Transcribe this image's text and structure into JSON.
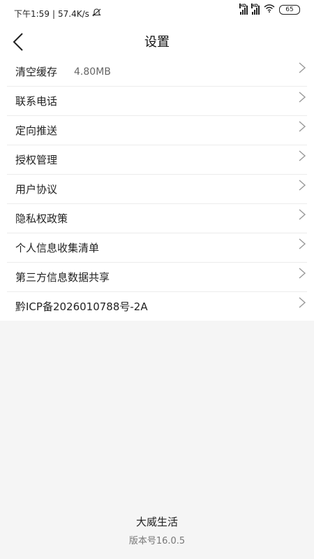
{
  "status": {
    "time": "下午1:59",
    "net_speed": "57.4K/s",
    "battery": "65",
    "signal_label": "HD"
  },
  "header": {
    "title": "设置"
  },
  "settings": [
    {
      "label": "清空缓存",
      "value": "4.80MB"
    },
    {
      "label": "联系电话",
      "value": ""
    },
    {
      "label": "定向推送",
      "value": ""
    },
    {
      "label": "授权管理",
      "value": ""
    },
    {
      "label": "用户协议",
      "value": ""
    },
    {
      "label": "隐私权政策",
      "value": ""
    },
    {
      "label": "个人信息收集清单",
      "value": ""
    },
    {
      "label": "第三方信息数据共享",
      "value": ""
    },
    {
      "label": "黔ICP备2026010788号-2A",
      "value": ""
    }
  ],
  "footer": {
    "app_name": "大威生活",
    "version": "版本号16.0.5"
  }
}
